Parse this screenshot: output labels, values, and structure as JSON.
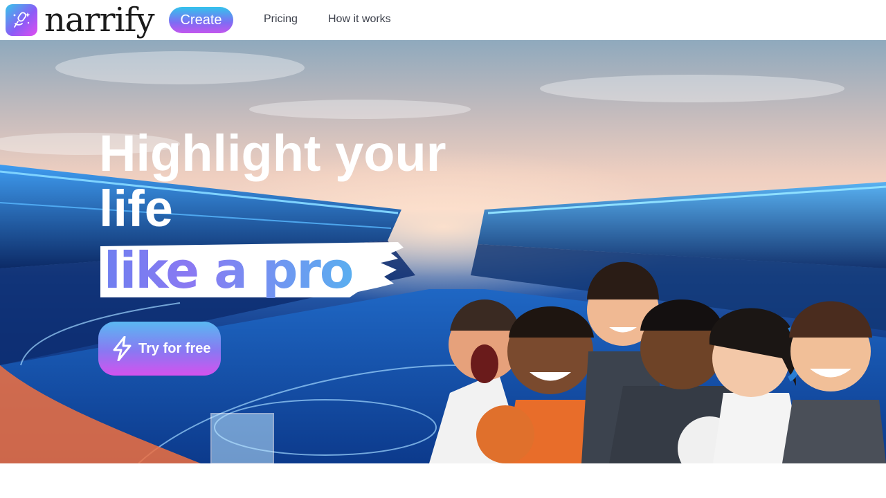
{
  "brand": {
    "name": "narrify",
    "icon": "microphone-sparkle-icon",
    "colors": {
      "gradient_start": "#36c6ea",
      "gradient_mid": "#8a5cf6",
      "gradient_end": "#e24df0"
    }
  },
  "nav": {
    "create_label": "Create",
    "pricing_label": "Pricing",
    "how_label": "How it works"
  },
  "hero": {
    "headline": "Highlight your life",
    "highlight": "like a pro",
    "cta_label": "Try for free",
    "cta_icon": "lightning-bolt-icon",
    "illustration": "stadium-with-cartoon-commentators"
  }
}
